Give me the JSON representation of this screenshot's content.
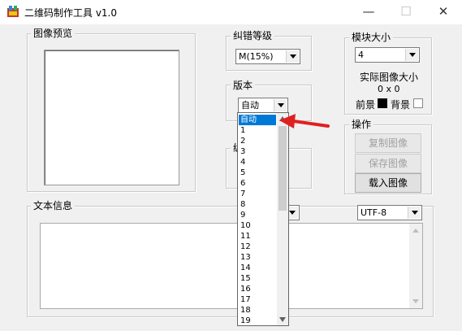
{
  "window": {
    "title": "二维码制作工具 v1.0",
    "minimize_glyph": "—",
    "maximize_glyph": "☐",
    "close_glyph": "✕"
  },
  "preview": {
    "label": "图像预览"
  },
  "error_level": {
    "label": "纠错等级",
    "value": "M(15%)"
  },
  "version": {
    "label": "版本",
    "value": "自动"
  },
  "encoding_label_partial": "编",
  "module_size": {
    "label": "模块大小",
    "value": "4",
    "actual_label": "实际图像大小",
    "actual_value": "0 x 0",
    "foreground_label": "前景",
    "background_label": "背景"
  },
  "operations": {
    "label": "操作",
    "copy": "复制图像",
    "save": "保存图像",
    "load": "载入图像"
  },
  "text_info": {
    "label": "文本信息",
    "charset": "UTF-8"
  },
  "version_options": [
    "自动",
    "1",
    "2",
    "3",
    "4",
    "5",
    "6",
    "7",
    "8",
    "9",
    "10",
    "11",
    "12",
    "13",
    "14",
    "15",
    "16",
    "17",
    "18",
    "19"
  ],
  "colors": {
    "foreground": "#000000",
    "background": "#ffffff",
    "accent": "#0078d7",
    "annotation_arrow": "#e02020"
  }
}
